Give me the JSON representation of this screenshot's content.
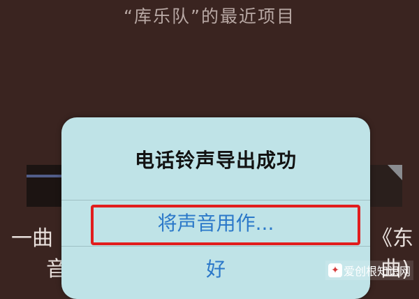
{
  "background": {
    "title": "“库乐队”的最近项目",
    "left_line1": "一曲 ",
    "left_line2": "音",
    "right_line1": "《东",
    "right_line2": "曲)"
  },
  "dialog": {
    "title": "电话铃声导出成功",
    "use_as_label": "将声音用作...",
    "ok_label": "好"
  },
  "watermark": {
    "icon_glyph": "✦",
    "text": "爱创根知识网"
  },
  "colors": {
    "dialog_bg": "#bfe3e7",
    "action_blue": "#2b78c9",
    "highlight_red": "#e11d1d"
  }
}
